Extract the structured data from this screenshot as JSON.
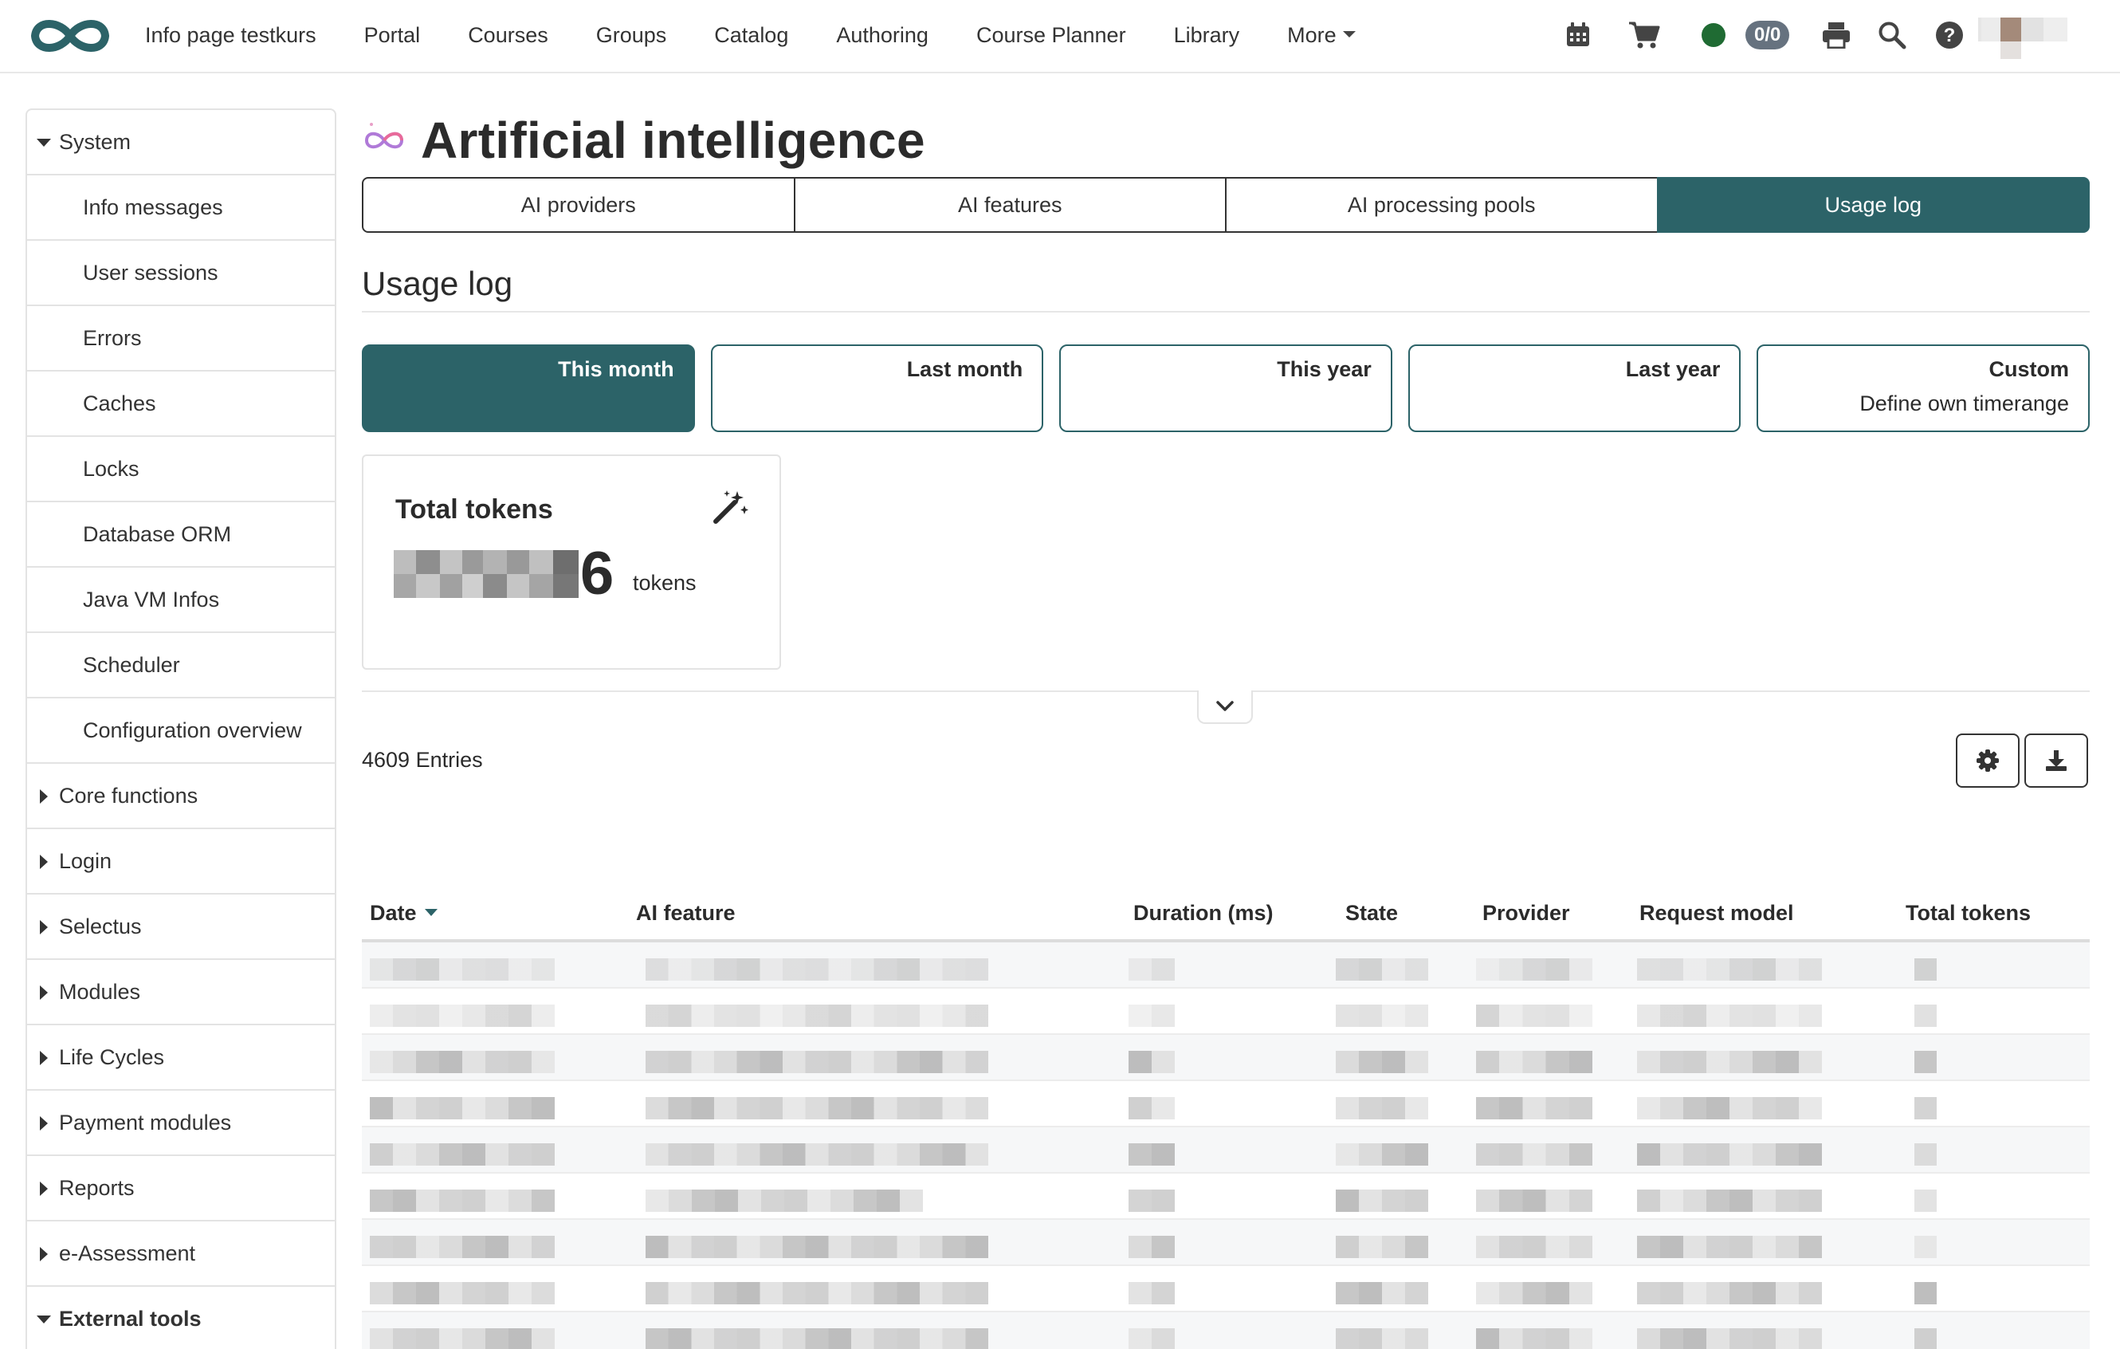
{
  "nav": {
    "items": [
      "Info page testkurs",
      "Portal",
      "Courses",
      "Groups",
      "Catalog",
      "Authoring",
      "Course Planner",
      "Library",
      "More"
    ],
    "counter": "0/0"
  },
  "sidebar": {
    "items": [
      {
        "label": "System",
        "level": "top",
        "state": "expanded"
      },
      {
        "label": "Info messages",
        "level": "sub"
      },
      {
        "label": "User sessions",
        "level": "sub"
      },
      {
        "label": "Errors",
        "level": "sub"
      },
      {
        "label": "Caches",
        "level": "sub"
      },
      {
        "label": "Locks",
        "level": "sub"
      },
      {
        "label": "Database ORM",
        "level": "sub"
      },
      {
        "label": "Java VM Infos",
        "level": "sub"
      },
      {
        "label": "Scheduler",
        "level": "sub"
      },
      {
        "label": "Configuration overview",
        "level": "sub"
      },
      {
        "label": "Core functions",
        "level": "top",
        "state": "collapsed"
      },
      {
        "label": "Login",
        "level": "top",
        "state": "collapsed"
      },
      {
        "label": "Selectus",
        "level": "top",
        "state": "collapsed"
      },
      {
        "label": "Modules",
        "level": "top",
        "state": "collapsed"
      },
      {
        "label": "Life Cycles",
        "level": "top",
        "state": "collapsed"
      },
      {
        "label": "Payment modules",
        "level": "top",
        "state": "collapsed"
      },
      {
        "label": "Reports",
        "level": "top",
        "state": "collapsed"
      },
      {
        "label": "e-Assessment",
        "level": "top",
        "state": "collapsed"
      },
      {
        "label": "External tools",
        "level": "top",
        "state": "expanded"
      }
    ]
  },
  "page": {
    "title": "Artificial intelligence",
    "tabs": [
      "AI providers",
      "AI features",
      "AI processing pools",
      "Usage log"
    ],
    "active_tab": "Usage log",
    "section_title": "Usage log"
  },
  "ranges": [
    {
      "label": "This month",
      "sub": "",
      "active": true
    },
    {
      "label": "Last month",
      "sub": "",
      "active": false
    },
    {
      "label": "This year",
      "sub": "",
      "active": false
    },
    {
      "label": "Last year",
      "sub": "",
      "active": false
    },
    {
      "label": "Custom",
      "sub": "Define own timerange",
      "active": false
    }
  ],
  "kpi": {
    "title": "Total tokens",
    "value_visible_digit": "6",
    "unit": "tokens",
    "icon": "magic-wand-icon"
  },
  "table": {
    "entries": "4609 Entries",
    "columns": [
      "Date",
      "AI feature",
      "Duration (ms)",
      "State",
      "Provider",
      "Request model",
      "Total tokens"
    ],
    "sorted_column": "Date",
    "sort_direction": "descending"
  },
  "colors": {
    "accent": "#2c6368",
    "status_online": "#1f6b33",
    "badge": "#66727f",
    "logo": "#2c6368"
  }
}
